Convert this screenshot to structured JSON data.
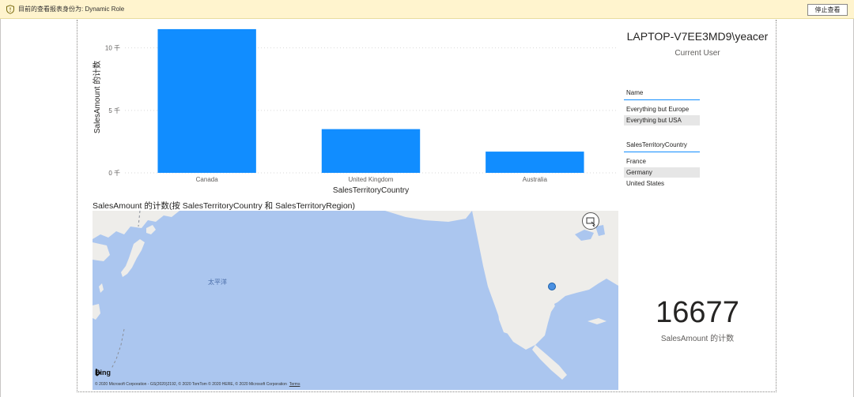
{
  "banner": {
    "message": "目前的查看报表身份为: Dynamic Role",
    "stop_label": "停止查看"
  },
  "user_card": {
    "value": "LAPTOP-V7EE3MD9\\yeacer",
    "label": "Current User"
  },
  "slicer_name": {
    "header": "Name",
    "items": [
      {
        "label": "Everything but Europe",
        "selected": false
      },
      {
        "label": "Everything but USA",
        "selected": true
      }
    ]
  },
  "slicer_country": {
    "header": "SalesTerritoryCountry",
    "items": [
      {
        "label": "France",
        "selected": false
      },
      {
        "label": "Germany",
        "selected": true
      },
      {
        "label": "United States",
        "selected": false
      }
    ]
  },
  "map": {
    "title": "SalesAmount 的计数(按 SalesTerritoryCountry 和 SalesTerritoryRegion)",
    "ocean_label": "太平洋",
    "brand": "Bing",
    "copyright": "© 2020 Microsoft Corporation - GS(2020)2192, © 2020 TomTom © 2020 HERE, © 2020 Microsoft Corporation",
    "terms": "Terms"
  },
  "kpi": {
    "value": "16677",
    "label": "SalesAmount 的计数"
  },
  "colors": {
    "accent": "#118dff",
    "banner_bg": "#fff4ce",
    "water": "#abc6ef",
    "land": "#eeedea"
  },
  "chart_data": {
    "type": "bar",
    "categories": [
      "Canada",
      "United Kingdom",
      "Australia"
    ],
    "values": [
      11500,
      3500,
      1700
    ],
    "xlabel": "SalesTerritoryCountry",
    "ylabel": "SalesAmount 的计数",
    "yticks": [
      {
        "value": 0,
        "label": "0 千"
      },
      {
        "value": 5000,
        "label": "5 千"
      },
      {
        "value": 10000,
        "label": "10 千"
      }
    ],
    "ylim": [
      0,
      12000
    ],
    "grid": true,
    "color": "#118dff"
  }
}
